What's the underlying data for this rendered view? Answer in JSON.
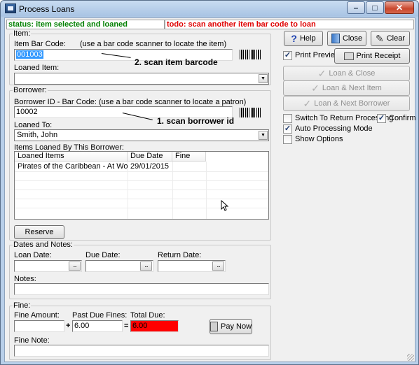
{
  "window": {
    "title": "Process Loans",
    "buttons": {
      "minimize": "–",
      "maximize": "□",
      "close": "✕"
    }
  },
  "status": {
    "left": "status: item selected and loaned",
    "right": "todo: scan another item bar code to loan"
  },
  "item": {
    "group_title": "Item:",
    "barcode_label": "Item Bar Code:",
    "barcode_hint": "(use a bar code scanner to locate the item)",
    "barcode_value": "001003",
    "loaned_item_label": "Loaned Item:",
    "loaned_item_value": ""
  },
  "borrower": {
    "group_title": "Borrower:",
    "id_label": "Borrower ID - Bar Code:",
    "id_hint": "(use a bar code scanner to locate a patron)",
    "id_value": "10002",
    "loaned_to_label": "Loaned To:",
    "loaned_to_value": "Smith, John",
    "items_label": "Items Loaned By This Borrower:",
    "columns": [
      "Loaned Items",
      "Due Date",
      "Fine"
    ],
    "rows": [
      [
        "Pirates of the Caribbean - At World's E...",
        "29/01/2015",
        ""
      ]
    ],
    "reserve_button": "Reserve"
  },
  "annotations": {
    "scan_item": "2. scan item barcode",
    "scan_borrower": "1. scan borrower id"
  },
  "dates": {
    "group_title": "Dates and Notes:",
    "loan_date_label": "Loan Date:",
    "loan_date_value": "",
    "due_date_label": "Due Date:",
    "due_date_value": "",
    "return_date_label": "Return Date:",
    "return_date_value": "",
    "picker_glyph": "...",
    "notes_label": "Notes:",
    "notes_value": ""
  },
  "fine": {
    "group_title": "Fine:",
    "amount_label": "Fine Amount:",
    "amount_value": "",
    "plus": "+",
    "past_due_label": "Past Due Fines:",
    "past_due_value": "6.00",
    "equals": "=",
    "total_due_label": "Total Due:",
    "total_due_value": "6.00",
    "pay_now_button": "Pay Now",
    "note_label": "Fine Note:",
    "note_value": ""
  },
  "actions": {
    "help": "Help",
    "close": "Close",
    "clear": "Clear",
    "print_preview": "Print Preview",
    "print_preview_checked": true,
    "print_receipt": "Print Receipt",
    "loan_close": "Loan & Close",
    "loan_next_item": "Loan & Next Item",
    "loan_next_borrower": "Loan & Next Borrower",
    "switch_return": "Switch To Return Processing",
    "switch_return_checked": false,
    "confirm": "Confirm",
    "confirm_checked": true,
    "auto_processing": "Auto Processing Mode",
    "auto_processing_checked": true,
    "show_options": "Show Options",
    "show_options_checked": false,
    "check_glyph": "✓"
  },
  "icons": {
    "help": "?",
    "clear": "✎",
    "loan": "✓"
  },
  "colors": {
    "status_ok": "#008000",
    "status_todo": "#e00000",
    "total_due_bg": "#ff0000",
    "selection": "#3399ff"
  }
}
